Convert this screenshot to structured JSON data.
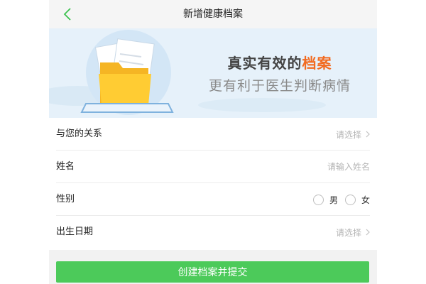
{
  "header": {
    "title": "新增健康档案"
  },
  "banner": {
    "headline_prefix": "真实有效的",
    "headline_highlight": "档案",
    "subline": "更有利于医生判断病情",
    "accent_color": "#f26b21"
  },
  "form": {
    "relation": {
      "label": "与您的关系",
      "value": "请选择"
    },
    "name": {
      "label": "姓名",
      "placeholder": "请输入姓名"
    },
    "gender": {
      "label": "性别",
      "options": [
        "男",
        "女"
      ]
    },
    "birthday": {
      "label": "出生日期",
      "value": "请选择"
    }
  },
  "submit": {
    "label": "创建档案并提交",
    "color": "#4cca5a"
  }
}
